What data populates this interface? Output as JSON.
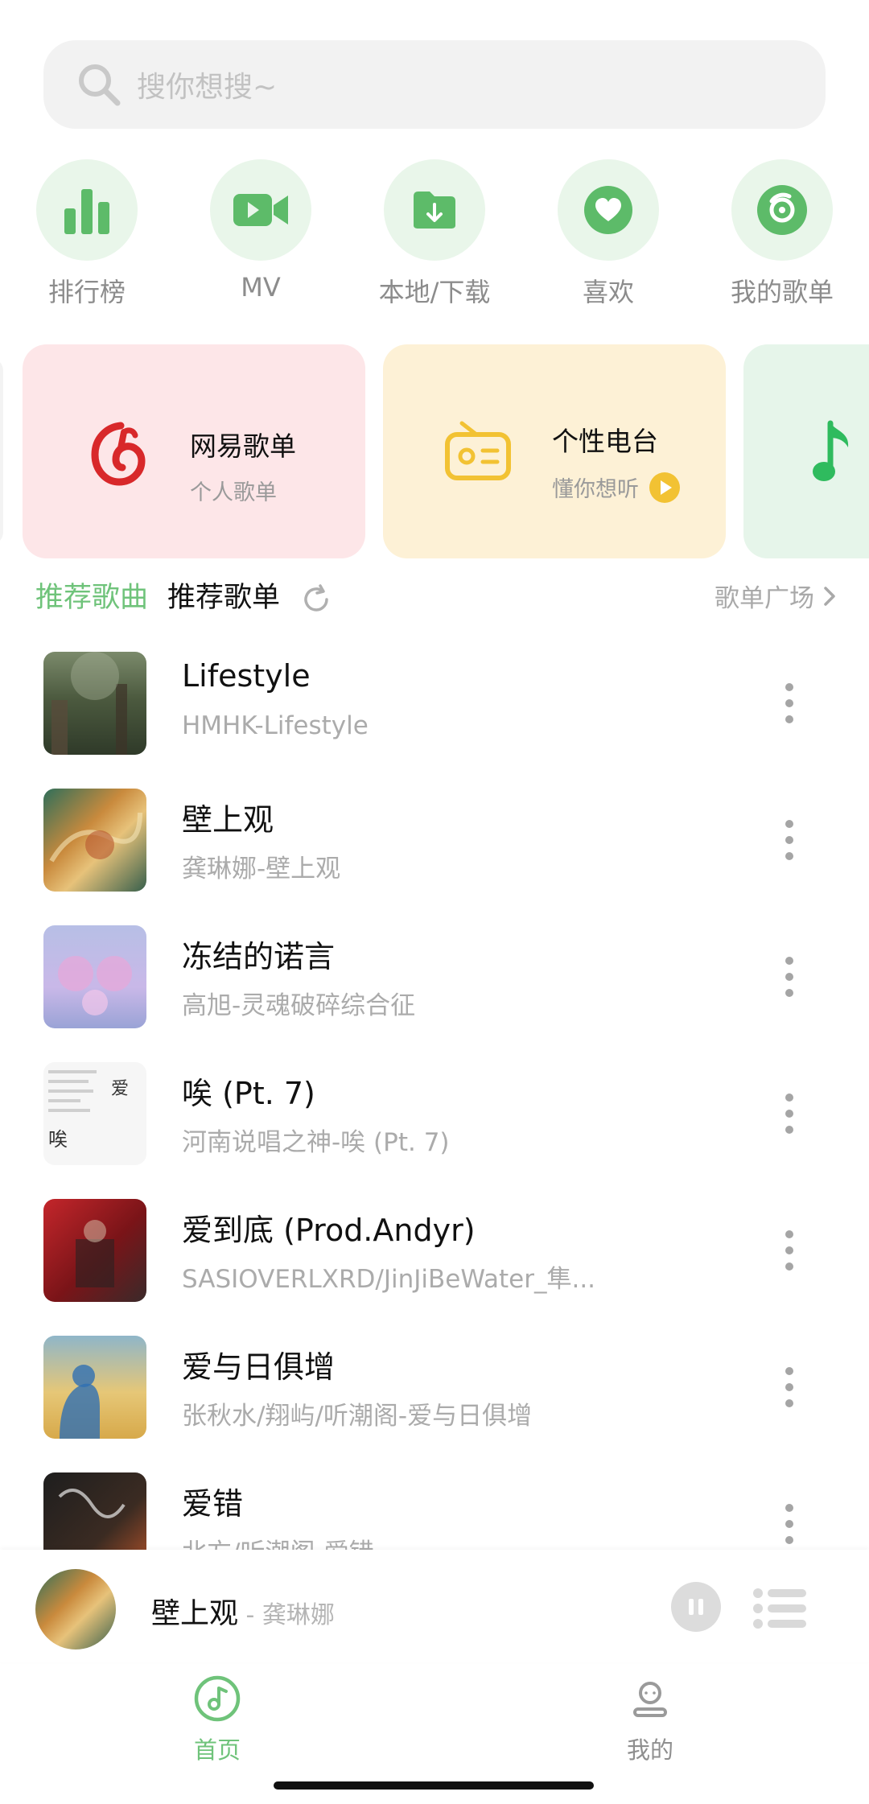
{
  "search": {
    "placeholder": "搜你想搜~"
  },
  "quick": [
    {
      "label": "排行榜",
      "icon": "bar-chart-icon"
    },
    {
      "label": "MV",
      "icon": "video-icon"
    },
    {
      "label": "本地/下载",
      "icon": "download-folder-icon"
    },
    {
      "label": "喜欢",
      "icon": "heart-icon"
    },
    {
      "label": "我的歌单",
      "icon": "disc-icon"
    }
  ],
  "cards": {
    "netease": {
      "title": "网易歌单",
      "sub": "个人歌单"
    },
    "radio": {
      "title": "个性电台",
      "sub": "懂你想听"
    }
  },
  "tabs": {
    "songs": "推荐歌曲",
    "playlists": "推荐歌单",
    "plaza": "歌单广场"
  },
  "songs": [
    {
      "title": "Lifestyle",
      "sub": "HMHK-Lifestyle"
    },
    {
      "title": "壁上观",
      "sub": "龚琳娜-壁上观"
    },
    {
      "title": "冻结的诺言",
      "sub": "高旭-灵魂破碎综合征"
    },
    {
      "title": "唉 (Pt. 7)",
      "sub": "河南说唱之神-唉 (Pt. 7)"
    },
    {
      "title": "爱到底 (Prod.Andyr)",
      "sub": "SASIOVERLXRD/JinJiBeWater_隼..."
    },
    {
      "title": "爱与日俱增",
      "sub": "张秋水/翔屿/听潮阁-爱与日俱增"
    },
    {
      "title": "爱错",
      "sub": "北方/听潮阁-爱错"
    }
  ],
  "player": {
    "title": "壁上观",
    "artist": " - 龚琳娜"
  },
  "nav": {
    "home": "首页",
    "mine": "我的"
  },
  "colors": {
    "accent": "#6fc37a",
    "netease_red": "#d8282a",
    "radio_yellow": "#f2c233"
  }
}
